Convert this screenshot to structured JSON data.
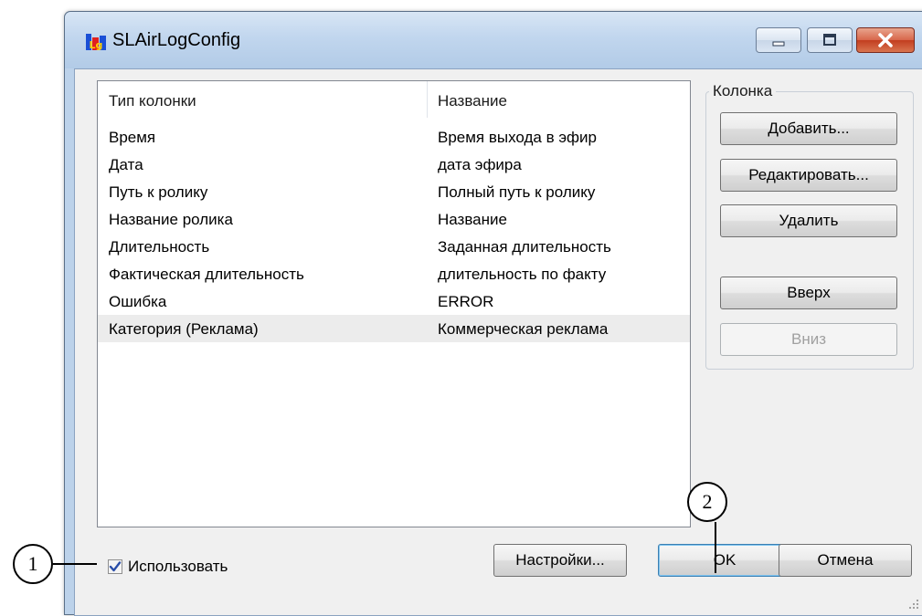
{
  "window": {
    "title": "SLAirLogConfig",
    "icon": "slairlog-app-icon"
  },
  "listview": {
    "columns": [
      "Тип колонки",
      "Название"
    ],
    "rows": [
      {
        "type": "Время",
        "name": "Время выхода в эфир"
      },
      {
        "type": "Дата",
        "name": "дата эфира"
      },
      {
        "type": "Путь к ролику",
        "name": "Полный путь к ролику"
      },
      {
        "type": "Название ролика",
        "name": "Название"
      },
      {
        "type": "Длительность",
        "name": "Заданная длительность"
      },
      {
        "type": "Фактическая длительность",
        "name": "длительность по факту"
      },
      {
        "type": "Ошибка",
        "name": "ERROR"
      },
      {
        "type": "Категория (Реклама)",
        "name": "Коммерческая реклама"
      }
    ],
    "selected_index": 7
  },
  "column_group": {
    "label": "Колонка",
    "add": "Добавить...",
    "edit": "Редактировать...",
    "delete": "Удалить",
    "up": "Вверх",
    "down": "Вниз"
  },
  "footer": {
    "use_label": "Использовать",
    "use_checked": true,
    "settings": "Настройки...",
    "ok": "OK",
    "cancel": "Отмена"
  },
  "callouts": [
    "1",
    "2"
  ]
}
